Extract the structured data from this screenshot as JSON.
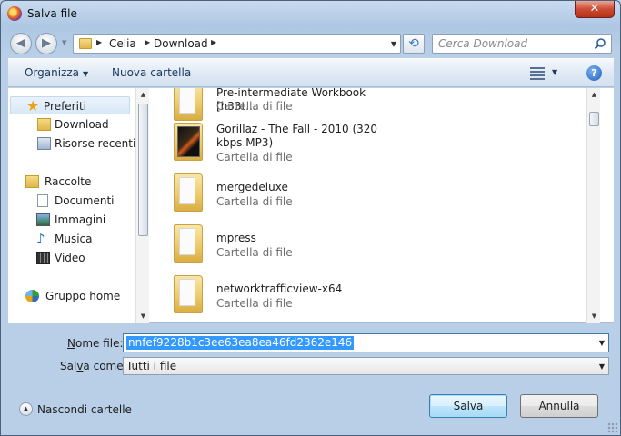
{
  "window": {
    "title": "Salva file",
    "close_label": "✕"
  },
  "address": {
    "crumbs": [
      "Celia",
      "Download"
    ],
    "search_placeholder": "Cerca Download"
  },
  "toolbar": {
    "organize_label": "Organizza",
    "new_folder_label": "Nuova cartella",
    "help_label": "?"
  },
  "nav_pane": {
    "items": [
      {
        "label": "Preferiti",
        "icon": "star-icon"
      },
      {
        "label": "Download",
        "icon": "download-folder-icon"
      },
      {
        "label": "Risorse recenti",
        "icon": "recent-places-icon"
      },
      {
        "label": "Raccolte",
        "icon": "libraries-icon"
      },
      {
        "label": "Documenti",
        "icon": "documents-icon"
      },
      {
        "label": "Immagini",
        "icon": "pictures-icon"
      },
      {
        "label": "Musica",
        "icon": "music-icon"
      },
      {
        "label": "Video",
        "icon": "video-icon"
      },
      {
        "label": "Gruppo home",
        "icon": "homegroup-icon"
      }
    ]
  },
  "files": [
    {
      "name": "Pre-intermediate Workbook [h33t...",
      "type": "Cartella di file",
      "thumb": "folder-icon"
    },
    {
      "name": "Gorillaz - The Fall - 2010 (320 kbps MP3)",
      "type": "Cartella di file",
      "thumb": "folder-photo-icon"
    },
    {
      "name": "mergedeluxe",
      "type": "Cartella di file",
      "thumb": "folder-icon"
    },
    {
      "name": "mpress",
      "type": "Cartella di file",
      "thumb": "folder-icon"
    },
    {
      "name": "networktrafficview-x64",
      "type": "Cartella di file",
      "thumb": "folder-icon"
    }
  ],
  "form": {
    "filename_label_pre": "N",
    "filename_label_rest": "ome file:",
    "filename_value": "nnfef9228b1c3ee63ea8ea46fd2362e146",
    "savetype_label_pre": "Sal",
    "savetype_label_u": "v",
    "savetype_label_rest": "a come:",
    "savetype_value": "Tutti i file"
  },
  "footer": {
    "hide_folders_label": "Nascondi cartelle",
    "save_label": "Salva",
    "cancel_label": "Annulla"
  }
}
